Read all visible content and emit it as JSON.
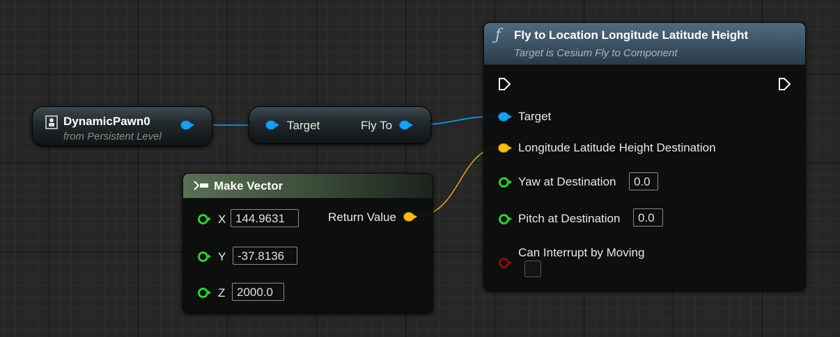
{
  "colors": {
    "object_pin": "#1aa0ef",
    "vector_pin": "#f5bf12",
    "float_pin": "#2fcf2f",
    "bool_pin": "#8a0d0d",
    "function_header": "#4f6b80",
    "pure_header": "#5a7055"
  },
  "pawn_node": {
    "title": "DynamicPawn0",
    "subtitle": "from Persistent Level",
    "icon": "actor-reference-icon"
  },
  "flyto_node": {
    "input_label": "Target",
    "output_label": "Fly To"
  },
  "make_vector": {
    "title": "Make Vector",
    "icon": "make-struct-icon",
    "inputs": [
      {
        "label": "X",
        "value": "144.9631"
      },
      {
        "label": "Y",
        "value": "-37.8136"
      },
      {
        "label": "Z",
        "value": "2000.0"
      }
    ],
    "output_label": "Return Value"
  },
  "function_node": {
    "title": "Fly to Location Longitude Latitude Height",
    "subtitle": "Target is Cesium Fly to Component",
    "icon": "function-icon",
    "pins": {
      "target": "Target",
      "destination": "Longitude Latitude Height Destination",
      "yaw_label": "Yaw at Destination",
      "yaw_value": "0.0",
      "pitch_label": "Pitch at Destination",
      "pitch_value": "0.0",
      "interrupt_label": "Can Interrupt by Moving"
    }
  }
}
